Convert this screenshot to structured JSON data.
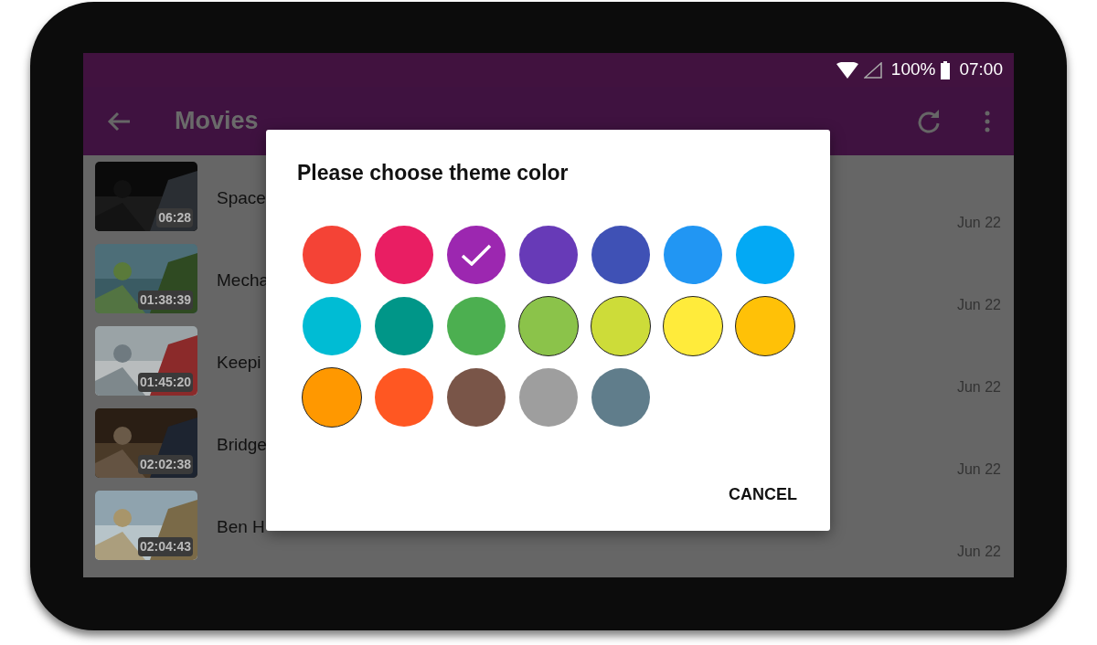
{
  "status_bar": {
    "battery": "100%",
    "time": "07:00"
  },
  "toolbar": {
    "title": "Movies"
  },
  "videos": [
    {
      "title": "Space",
      "duration": "06:28",
      "date": "Jun 22"
    },
    {
      "title": "Mecha",
      "duration": "01:38:39",
      "date": "Jun 22"
    },
    {
      "title": "Keepi",
      "duration": "01:45:20",
      "date": "Jun 22"
    },
    {
      "title": "Bridge",
      "duration": "02:02:38",
      "date": "Jun 22"
    },
    {
      "title": "Ben H",
      "duration": "02:04:43",
      "date": "Jun 22"
    }
  ],
  "dialog": {
    "title": "Please choose theme color",
    "swatches": [
      {
        "color": "#f44336",
        "selected": false,
        "outlined": false
      },
      {
        "color": "#e91e63",
        "selected": false,
        "outlined": false
      },
      {
        "color": "#9c27b0",
        "selected": true,
        "outlined": false
      },
      {
        "color": "#673ab7",
        "selected": false,
        "outlined": false
      },
      {
        "color": "#3f51b5",
        "selected": false,
        "outlined": false
      },
      {
        "color": "#2196f3",
        "selected": false,
        "outlined": false
      },
      {
        "color": "#03a9f4",
        "selected": false,
        "outlined": false
      },
      {
        "color": "#00bcd4",
        "selected": false,
        "outlined": false
      },
      {
        "color": "#009688",
        "selected": false,
        "outlined": false
      },
      {
        "color": "#4caf50",
        "selected": false,
        "outlined": false
      },
      {
        "color": "#8bc34a",
        "selected": false,
        "outlined": true
      },
      {
        "color": "#cddc39",
        "selected": false,
        "outlined": true
      },
      {
        "color": "#ffeb3b",
        "selected": false,
        "outlined": true
      },
      {
        "color": "#ffc107",
        "selected": false,
        "outlined": true
      },
      {
        "color": "#ff9800",
        "selected": false,
        "outlined": true
      },
      {
        "color": "#ff5722",
        "selected": false,
        "outlined": false
      },
      {
        "color": "#795548",
        "selected": false,
        "outlined": false
      },
      {
        "color": "#9e9e9e",
        "selected": false,
        "outlined": false
      },
      {
        "color": "#607d8b",
        "selected": false,
        "outlined": false
      }
    ],
    "button": "CANCEL"
  }
}
